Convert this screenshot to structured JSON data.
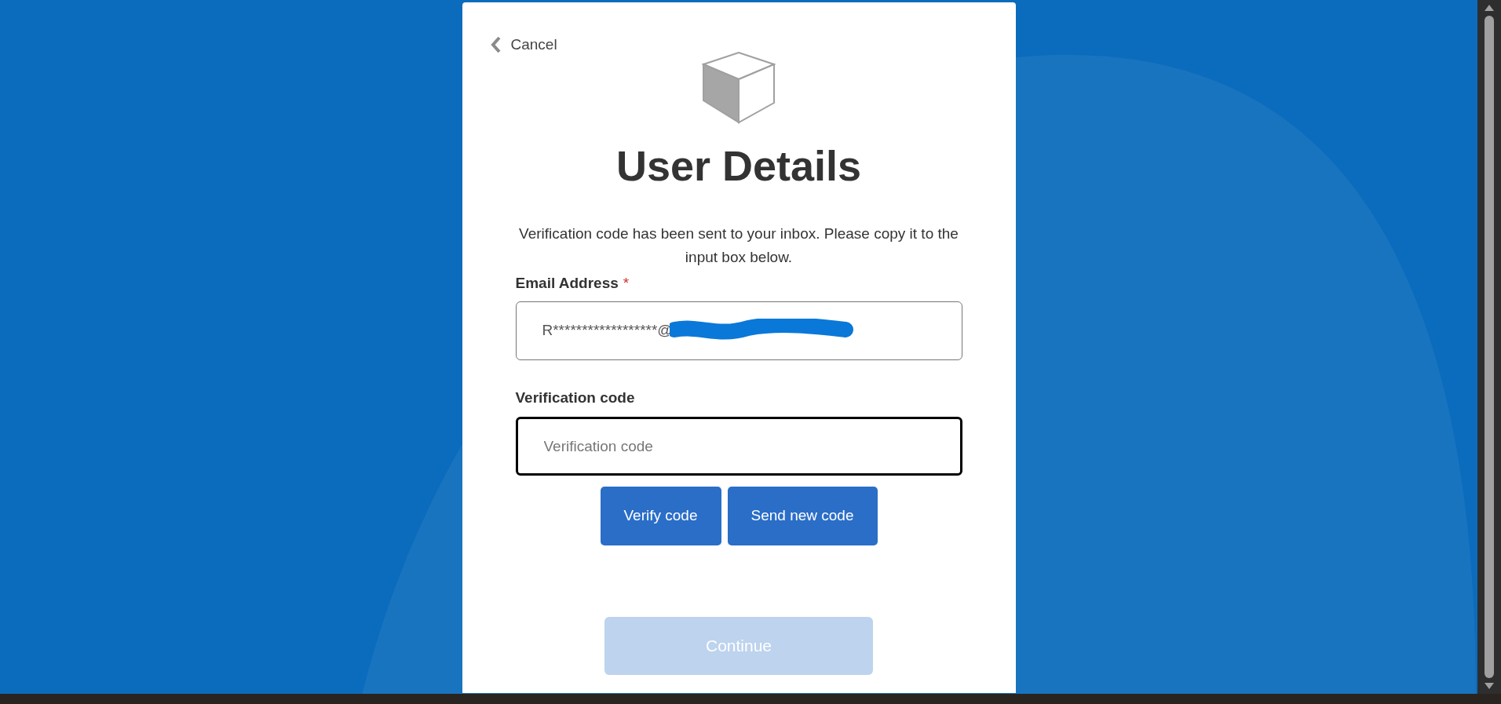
{
  "cancel": {
    "label": "Cancel"
  },
  "title": "User Details",
  "message": "Verification code has been sent to your inbox. Please copy it to the input box below.",
  "email": {
    "label": "Email Address",
    "required": true,
    "required_mark": "*",
    "value": "R******************@",
    "redacted": true
  },
  "verification": {
    "label": "Verification code",
    "placeholder": "Verification code",
    "focused": true
  },
  "buttons": [
    {
      "label": "Verify code",
      "disabled": false
    },
    {
      "label": "Send new code",
      "disabled": false
    }
  ],
  "continue": {
    "label": "Continue",
    "disabled": true
  }
}
